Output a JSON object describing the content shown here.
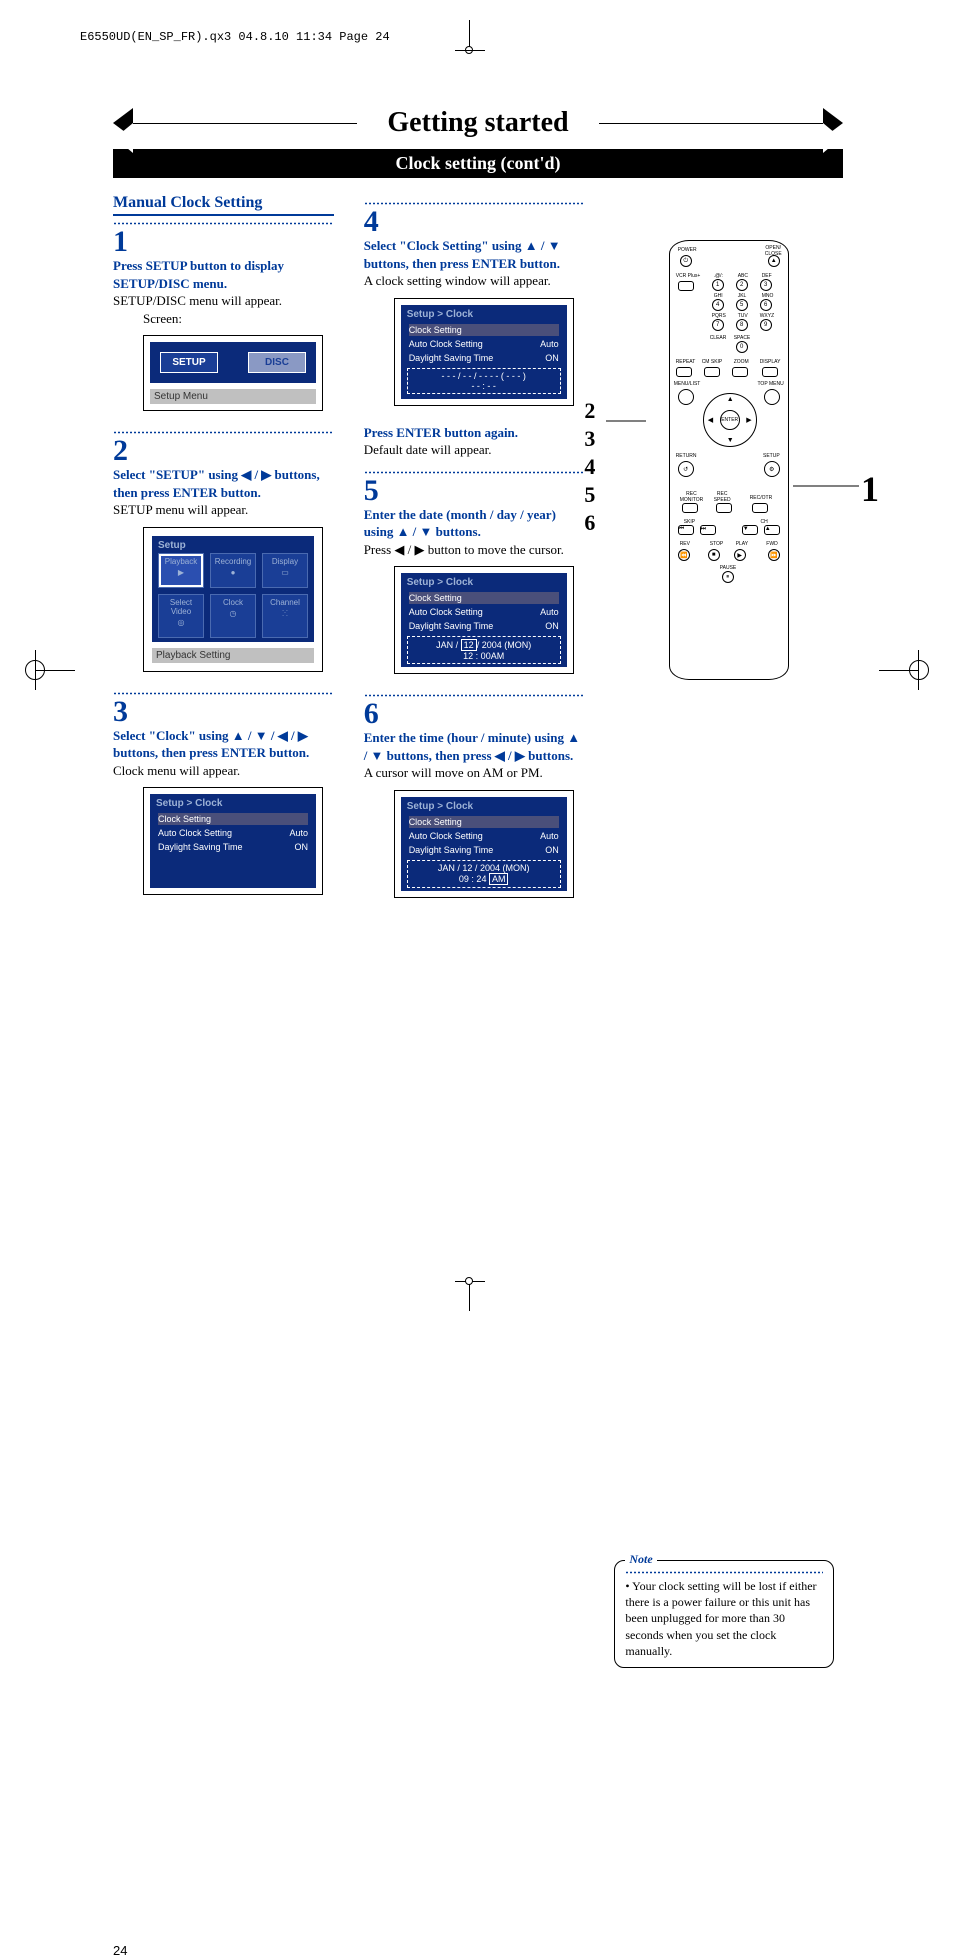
{
  "print_header": "E6550UD(EN_SP_FR).qx3  04.8.10  11:34  Page 24",
  "banner": {
    "title": "Getting started",
    "subtitle": "Clock setting (cont'd)"
  },
  "section_heading": "Manual Clock Setting",
  "steps": {
    "s1": {
      "num": "1",
      "bold": "Press SETUP button to display SETUP/DISC menu.",
      "body": "SETUP/DISC menu will appear.",
      "indent": "Screen:",
      "screen": {
        "setup": "SETUP",
        "disc": "DISC",
        "label": "Setup Menu"
      }
    },
    "s2": {
      "num": "2",
      "bold": "Select \"SETUP\" using ◀ / ▶ buttons, then press ENTER button.",
      "body": "SETUP menu will appear.",
      "screen": {
        "title": "Setup",
        "cells": [
          "Playback",
          "Recording",
          "Display",
          "Select Video",
          "Clock",
          "Channel"
        ],
        "label": "Playback Setting"
      }
    },
    "s3": {
      "num": "3",
      "bold": "Select \"Clock\" using ▲ / ▼ / ◀ / ▶ buttons, then press ENTER button.",
      "body": "Clock menu will appear.",
      "screen": {
        "title": "Setup > Clock",
        "row1": "Clock Setting",
        "row2l": "Auto Clock Setting",
        "row2r": "Auto",
        "row3l": "Daylight Saving Time",
        "row3r": "ON"
      }
    },
    "s4": {
      "num": "4",
      "bold": "Select \"Clock Setting\" using ▲ / ▼ buttons, then press ENTER button.",
      "body": "A clock setting window will appear.",
      "screen": {
        "title": "Setup > Clock",
        "row1": "Clock Setting",
        "row2l": "Auto Clock Setting",
        "row2r": "Auto",
        "row3l": "Daylight Saving Time",
        "row3r": "ON",
        "date": "- - - / - - / - - - - ( - - - )",
        "time": "- - : - -"
      },
      "post_bold": "Press ENTER button again.",
      "post_body": "Default date will appear."
    },
    "s5": {
      "num": "5",
      "bold": "Enter the date (month / day / year) using ▲ / ▼ buttons.",
      "body": "Press ◀ / ▶ button to move the cursor.",
      "screen": {
        "title": "Setup > Clock",
        "row1": "Clock Setting",
        "row2l": "Auto Clock Setting",
        "row2r": "Auto",
        "row3l": "Daylight Saving Time",
        "row3r": "ON",
        "date_pre": "JAN / ",
        "date_sel": "12",
        "date_post": "/ 2004 (MON)",
        "time": "12 : 00AM"
      }
    },
    "s6": {
      "num": "6",
      "bold": "Enter the time (hour / minute) using ▲ / ▼ buttons, then press ◀ / ▶ buttons.",
      "body": "A cursor will move on AM or PM.",
      "screen": {
        "title": "Setup > Clock",
        "row1": "Clock Setting",
        "row2l": "Auto Clock Setting",
        "row2r": "Auto",
        "row3l": "Daylight Saving Time",
        "row3r": "ON",
        "date": "JAN / 12 / 2004 (MON)",
        "time_pre": "09 : 24 ",
        "time_sel": "AM"
      }
    }
  },
  "remote_callouts": {
    "right": "1",
    "left": [
      "2",
      "3",
      "4",
      "5",
      "6"
    ]
  },
  "remote_labels": {
    "power": "POWER",
    "open": "OPEN/\nCLOSE",
    "vcrplus": "VCR Plus+",
    "at": ".@/:",
    "abc": "ABC",
    "def": "DEF",
    "ghi": "GHI",
    "jkl": "JKL",
    "mno": "MNO",
    "pqrs": "PQRS",
    "tuv": "TUV",
    "wxyz": "WXYZ",
    "clear": "CLEAR",
    "space": "SPACE",
    "repeat": "REPEAT",
    "cmskip": "CM SKIP",
    "zoom": "ZOOM",
    "display": "DISPLAY",
    "menulist": "MENU/LIST",
    "topmenu": "TOP MENU",
    "return": "RETURN",
    "setup": "SETUP",
    "enter": "ENTER",
    "recmon": "REC\nMONITOR",
    "recspeed": "REC\nSPEED",
    "recotr": "REC/OTR",
    "skip": "SKIP",
    "ch": "CH",
    "rev": "REV",
    "stop": "STOP",
    "play": "PLAY",
    "fwd": "FWD",
    "pause": "PAUSE"
  },
  "note": {
    "title": "Note",
    "body": "• Your clock setting will be lost if either there is a power failure or this unit has been unplugged for more than 30 seconds when you set the clock manually."
  },
  "page_number": "24"
}
